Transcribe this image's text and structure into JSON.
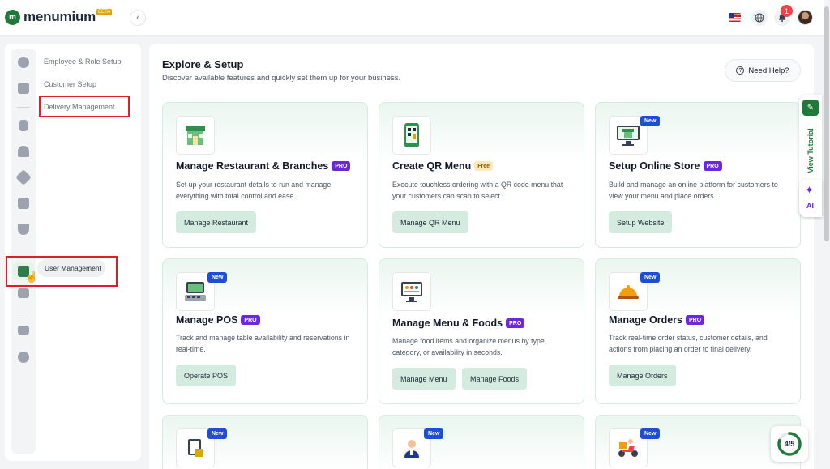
{
  "app": {
    "logo_text": "menumium",
    "logo_badge": "BETA"
  },
  "topbar": {
    "collapse_icon": "chevron-left-icon",
    "language": "en-US",
    "notification_count": "1"
  },
  "sidebar": {
    "menu": [
      {
        "label": "Employee & Role Setup"
      },
      {
        "label": "Customer Setup"
      },
      {
        "label": "Delivery Management"
      }
    ],
    "tooltip": "User Management"
  },
  "main": {
    "title": "Explore & Setup",
    "subtitle": "Discover available features and quickly set them up for your business.",
    "help_label": "Need Help?"
  },
  "cards": [
    {
      "title": "Manage Restaurant & Branches",
      "tag": "PRO",
      "desc": "Set up your restaurant details to run and manage everything with total control and ease.",
      "buttons": [
        "Manage Restaurant"
      ],
      "new": false
    },
    {
      "title": "Create QR Menu",
      "tag": "Free",
      "desc": "Execute touchless ordering with a QR code menu that your customers can scan to select.",
      "buttons": [
        "Manage QR Menu"
      ],
      "new": false
    },
    {
      "title": "Setup Online Store",
      "tag": "PRO",
      "desc": "Build and manage an online platform for customers to view your menu and place orders.",
      "buttons": [
        "Setup Website"
      ],
      "new": true,
      "new_label": "New"
    },
    {
      "title": "Manage POS",
      "tag": "PRO",
      "desc": "Track and manage table availability and reservations in real-time.",
      "buttons": [
        "Operate POS"
      ],
      "new": true,
      "new_label": "New"
    },
    {
      "title": "Manage Menu & Foods",
      "tag": "PRO",
      "desc": "Manage food items and organize menus by type, category, or availability in seconds.",
      "buttons": [
        "Manage Menu",
        "Manage Foods"
      ],
      "new": false
    },
    {
      "title": "Manage Orders",
      "tag": "PRO",
      "desc": "Track real-time order status, customer details, and actions from placing an order to final delivery.",
      "buttons": [
        "Manage Orders"
      ],
      "new": true,
      "new_label": "New"
    }
  ],
  "bottom_new_label": "New",
  "side_tabs": {
    "tutorial_label": "View Tutorial",
    "ai_label": "AI"
  },
  "progress": {
    "label": "4/5",
    "done": 4,
    "total": 5
  },
  "colors": {
    "brand": "#1f7a3a",
    "pro": "#6d28d9",
    "new": "#1d4ed8",
    "button": "#d4ebe0",
    "highlight": "#e11d2b"
  }
}
